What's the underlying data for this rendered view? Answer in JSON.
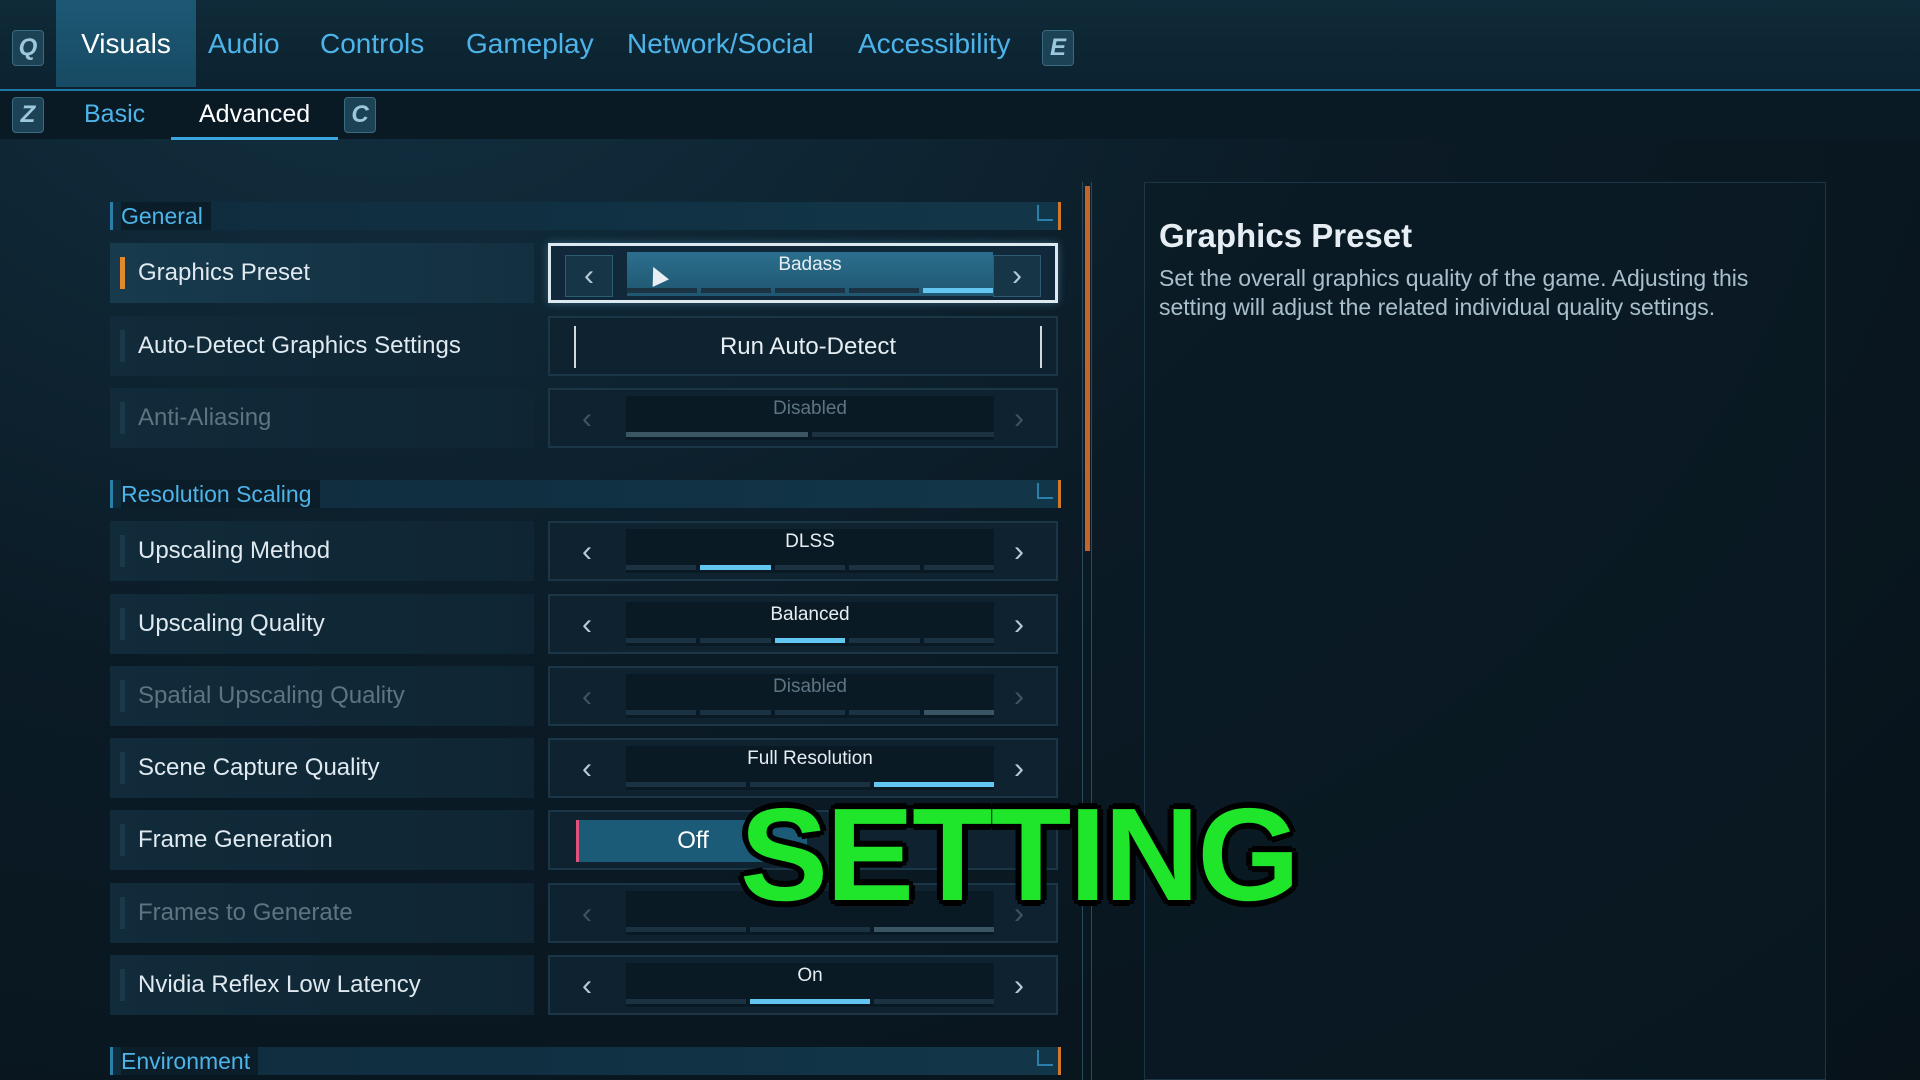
{
  "top_nav": {
    "left_key": "Q",
    "right_key": "E",
    "tabs": [
      "Visuals",
      "Audio",
      "Controls",
      "Gameplay",
      "Network/Social",
      "Accessibility"
    ],
    "active": "Visuals"
  },
  "sub_nav": {
    "left_key": "Z",
    "right_key": "C",
    "tabs": [
      "Basic",
      "Advanced"
    ],
    "active": "Advanced"
  },
  "sections": {
    "general": "General",
    "resolution_scaling": "Resolution Scaling",
    "environment": "Environment"
  },
  "settings": {
    "graphics_preset": {
      "label": "Graphics Preset",
      "value": "Badass",
      "level": 5,
      "levels": 5
    },
    "auto_detect": {
      "label": "Auto-Detect Graphics Settings",
      "button": "Run Auto-Detect"
    },
    "anti_aliasing": {
      "label": "Anti-Aliasing",
      "value": "Disabled",
      "level": 1,
      "levels": 2,
      "disabled": true
    },
    "upscaling_method": {
      "label": "Upscaling Method",
      "value": "DLSS",
      "level": 2,
      "levels": 5
    },
    "upscaling_quality": {
      "label": "Upscaling Quality",
      "value": "Balanced",
      "level": 3,
      "levels": 5
    },
    "spatial_upscaling_quality": {
      "label": "Spatial Upscaling Quality",
      "value": "Disabled",
      "level": 5,
      "levels": 5,
      "disabled": true
    },
    "scene_capture_quality": {
      "label": "Scene Capture Quality",
      "value": "Full Resolution",
      "level": 3,
      "levels": 3
    },
    "frame_generation": {
      "label": "Frame Generation",
      "value": "Off"
    },
    "frames_to_generate": {
      "label": "Frames to Generate",
      "level": 3,
      "levels": 3,
      "disabled": true
    },
    "nvidia_reflex": {
      "label": "Nvidia Reflex Low Latency",
      "value": "On",
      "level": 2,
      "levels": 3
    }
  },
  "description": {
    "title": "Graphics Preset",
    "text": "Set the overall graphics quality of the game. Adjusting this setting will adjust the related individual quality settings."
  },
  "overlay_caption": "SETTING",
  "colors": {
    "accent_blue": "#4db4ea",
    "selection_orange": "#e08a2c",
    "overlay_green": "#1fe62a"
  }
}
